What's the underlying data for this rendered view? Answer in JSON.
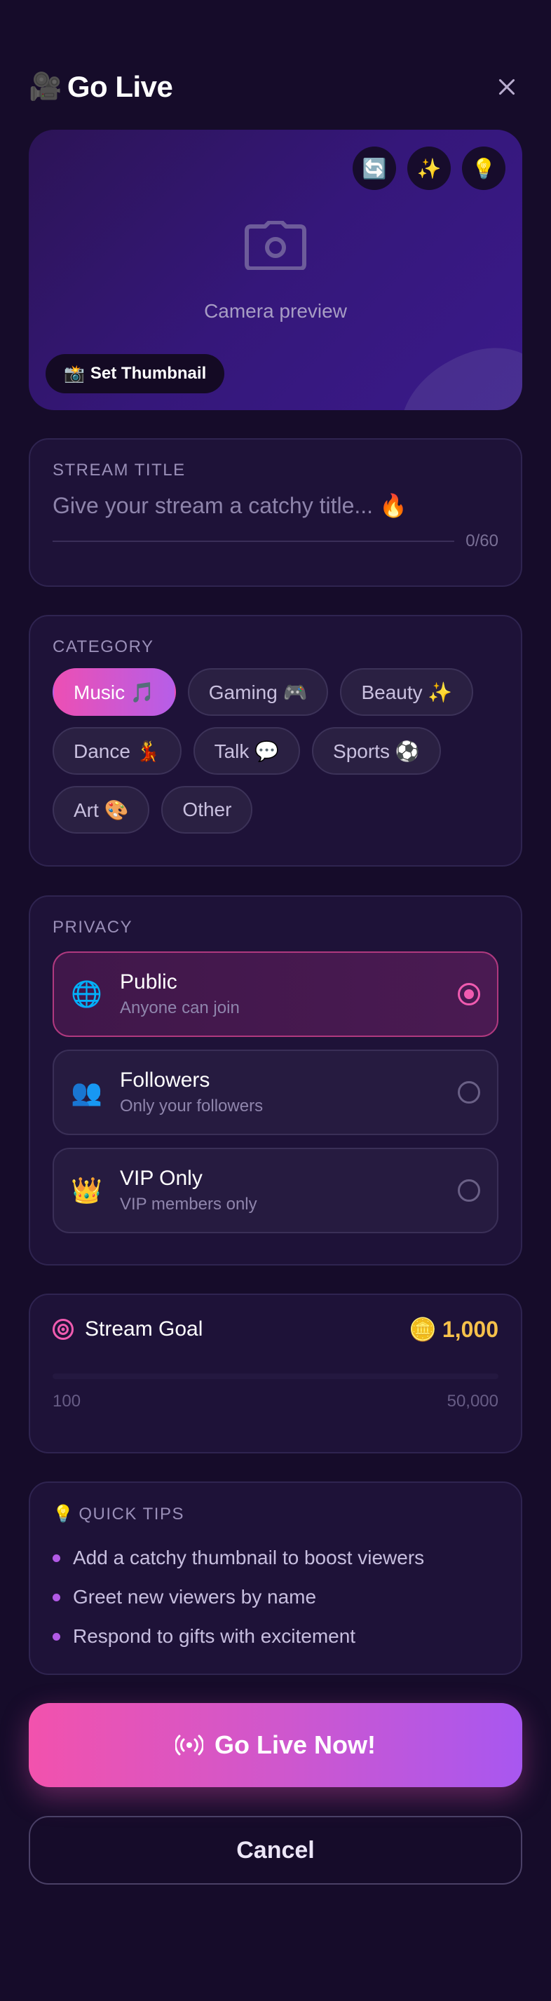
{
  "header": {
    "title_emoji": "🎥",
    "title": "Go Live"
  },
  "preview": {
    "tools": [
      {
        "name": "flip-camera-icon",
        "glyph": "🔄"
      },
      {
        "name": "effects-icon",
        "glyph": "✨"
      },
      {
        "name": "light-icon",
        "glyph": "💡"
      }
    ],
    "camera_label": "Camera preview",
    "thumbnail_emoji": "📸",
    "thumbnail_label": "Set Thumbnail"
  },
  "stream_title": {
    "label": "STREAM TITLE",
    "placeholder": "Give your stream a catchy title... 🔥",
    "value": "",
    "counter": "0/60"
  },
  "category": {
    "label": "CATEGORY",
    "chips": [
      {
        "label": "Music 🎵",
        "active": true
      },
      {
        "label": "Gaming 🎮",
        "active": false
      },
      {
        "label": "Beauty ✨",
        "active": false
      },
      {
        "label": "Dance 💃",
        "active": false
      },
      {
        "label": "Talk 💬",
        "active": false
      },
      {
        "label": "Sports ⚽",
        "active": false
      },
      {
        "label": "Art 🎨",
        "active": false
      },
      {
        "label": "Other",
        "active": false
      }
    ]
  },
  "privacy": {
    "label": "PRIVACY",
    "options": [
      {
        "icon": "🌐",
        "name": "Public",
        "desc": "Anyone can join",
        "selected": true
      },
      {
        "icon": "👥",
        "name": "Followers",
        "desc": "Only your followers",
        "selected": false
      },
      {
        "icon": "👑",
        "name": "VIP Only",
        "desc": "VIP members only",
        "selected": false
      }
    ]
  },
  "goal": {
    "label": "Stream Goal",
    "coin_emoji": "🪙",
    "value": "1,000",
    "min": "100",
    "max": "50,000"
  },
  "tips": {
    "emoji": "💡",
    "label": "QUICK TIPS",
    "items": [
      "Add a catchy thumbnail to boost viewers",
      "Greet new viewers by name",
      "Respond to gifts with excitement"
    ]
  },
  "actions": {
    "go_live": "Go Live Now!",
    "cancel": "Cancel"
  },
  "colors": {
    "background": "#160c2a",
    "accent_pink": "#f252ad",
    "accent_purple": "#a857f0",
    "goal_gold": "#f6c14b"
  }
}
